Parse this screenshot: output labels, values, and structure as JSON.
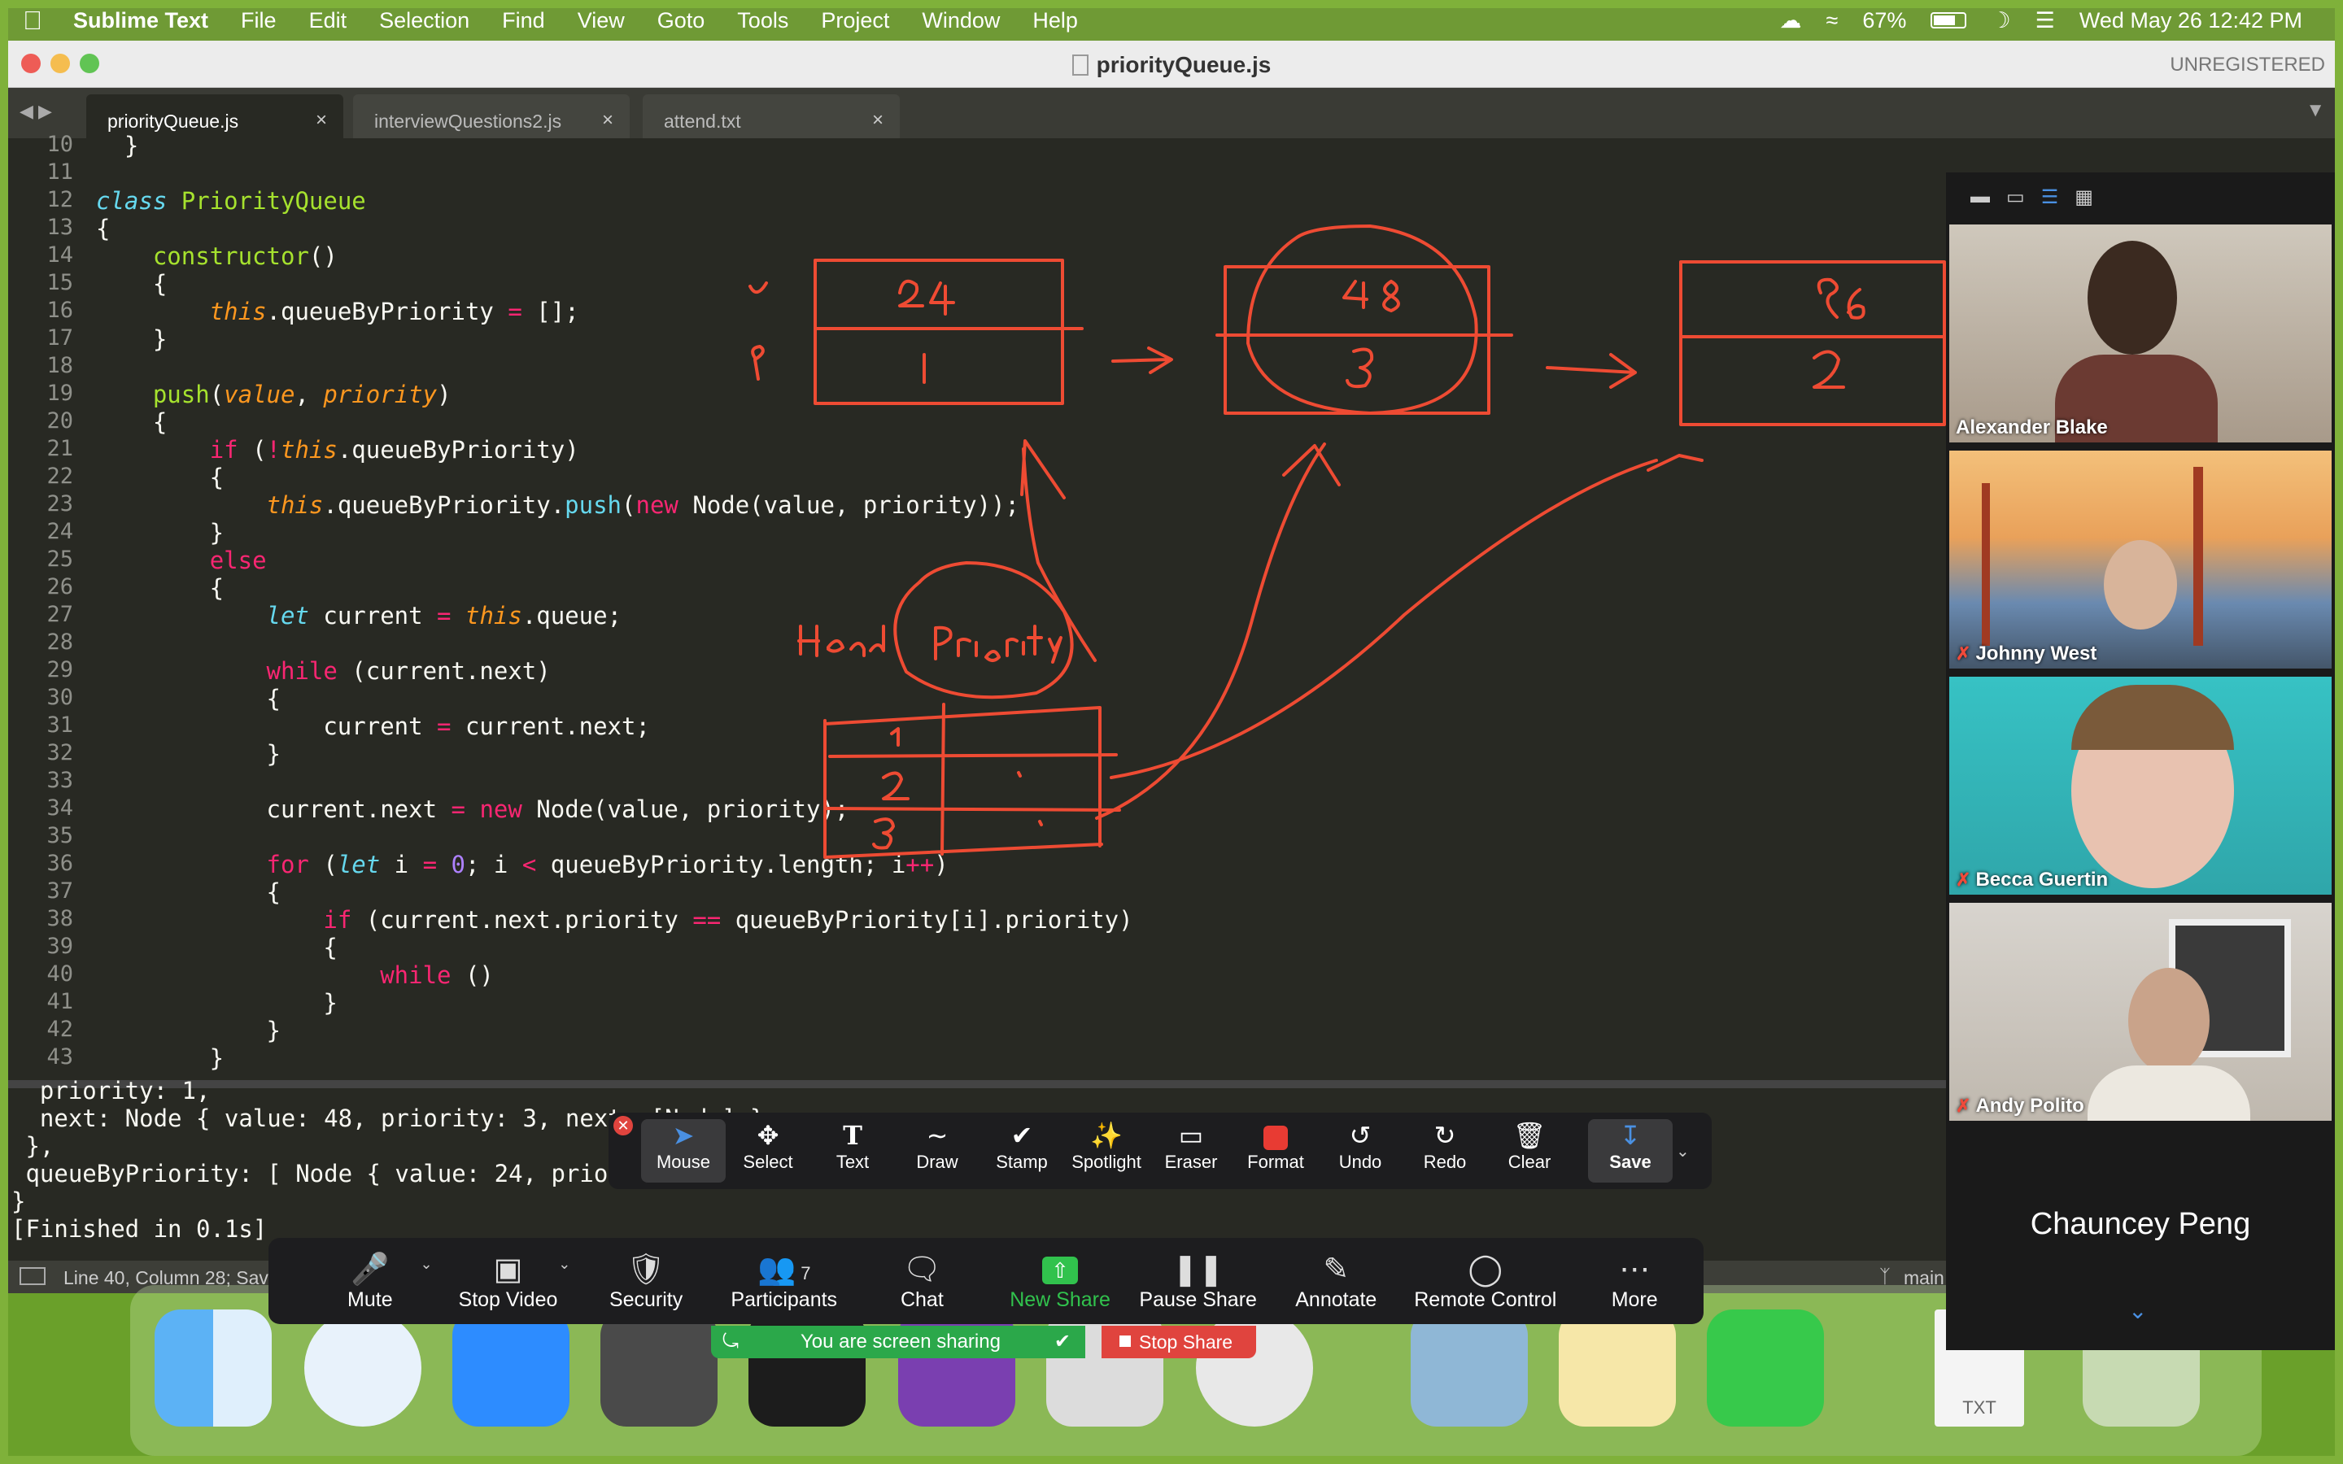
{
  "menubar": {
    "app": "Sublime Text",
    "items": [
      "File",
      "Edit",
      "Selection",
      "Find",
      "View",
      "Goto",
      "Tools",
      "Project",
      "Window",
      "Help"
    ],
    "battery": "67%",
    "datetime": "Wed May 26  12:42 PM"
  },
  "window": {
    "title": "priorityQueue.js",
    "unregistered": "UNREGISTERED",
    "tabs": [
      {
        "label": "priorityQueue.js",
        "close": "×"
      },
      {
        "label": "interviewQuestions2.js",
        "close": "×"
      },
      {
        "label": "attend.txt",
        "close": "×"
      }
    ]
  },
  "code": {
    "line_numbers": [
      "10",
      "11",
      "12",
      "13",
      "14",
      "15",
      "16",
      "17",
      "18",
      "19",
      "20",
      "21",
      "22",
      "23",
      "24",
      "25",
      "26",
      "27",
      "28",
      "29",
      "30",
      "31",
      "32",
      "33",
      "34",
      "35",
      "36",
      "37",
      "38",
      "39",
      "40",
      "41",
      "42",
      "43"
    ]
  },
  "console": {
    "lines": [
      "  priority: 1,",
      "  next: Node { value: 48, priority: 3, next: [Node] }",
      " },",
      " queueByPriority: [ Node { value: 24, priorit",
      "}",
      "[Finished in 0.1s]"
    ]
  },
  "status": {
    "position": "Line 40, Column 28; Sav",
    "branch": "main"
  },
  "annotate": {
    "tools": [
      {
        "label": "Mouse",
        "icon": "cursor-icon"
      },
      {
        "label": "Select",
        "icon": "move-icon"
      },
      {
        "label": "Text",
        "icon": "text-icon"
      },
      {
        "label": "Draw",
        "icon": "squiggle-icon"
      },
      {
        "label": "Stamp",
        "icon": "check-icon"
      },
      {
        "label": "Spotlight",
        "icon": "spotlight-icon"
      },
      {
        "label": "Eraser",
        "icon": "eraser-icon"
      },
      {
        "label": "Format",
        "icon": "format-icon"
      },
      {
        "label": "Undo",
        "icon": "undo-icon"
      },
      {
        "label": "Redo",
        "icon": "redo-icon"
      },
      {
        "label": "Clear",
        "icon": "trash-icon"
      },
      {
        "label": "Save",
        "icon": "save-icon"
      }
    ]
  },
  "gallery": {
    "participants": [
      {
        "name": "Alexander Blake"
      },
      {
        "name": "Johnny West"
      },
      {
        "name": "Becca Guertin"
      },
      {
        "name": "Andy Polito"
      }
    ],
    "speaker": "Chauncey Peng"
  },
  "zoom_controls": {
    "items": [
      {
        "label": "Mute",
        "icon": "microphone-icon"
      },
      {
        "label": "Stop Video",
        "icon": "video-camera-icon"
      },
      {
        "label": "Security",
        "icon": "shield-icon"
      },
      {
        "label": "Participants",
        "icon": "participants-icon",
        "count": "7"
      },
      {
        "label": "Chat",
        "icon": "chat-icon"
      },
      {
        "label": "New Share",
        "icon": "share-icon"
      },
      {
        "label": "Pause Share",
        "icon": "pause-icon"
      },
      {
        "label": "Annotate",
        "icon": "pencil-icon"
      },
      {
        "label": "Remote Control",
        "icon": "mouse-icon"
      },
      {
        "label": "More",
        "icon": "more-icon"
      }
    ],
    "sharing_status": "You are screen sharing",
    "stop_share": "Stop Share"
  },
  "dock": {
    "file_label": "TXT"
  },
  "colors": {
    "accent_green": "#7fb13a",
    "ink_red": "#ee4b33",
    "editor_bg": "#282923"
  }
}
